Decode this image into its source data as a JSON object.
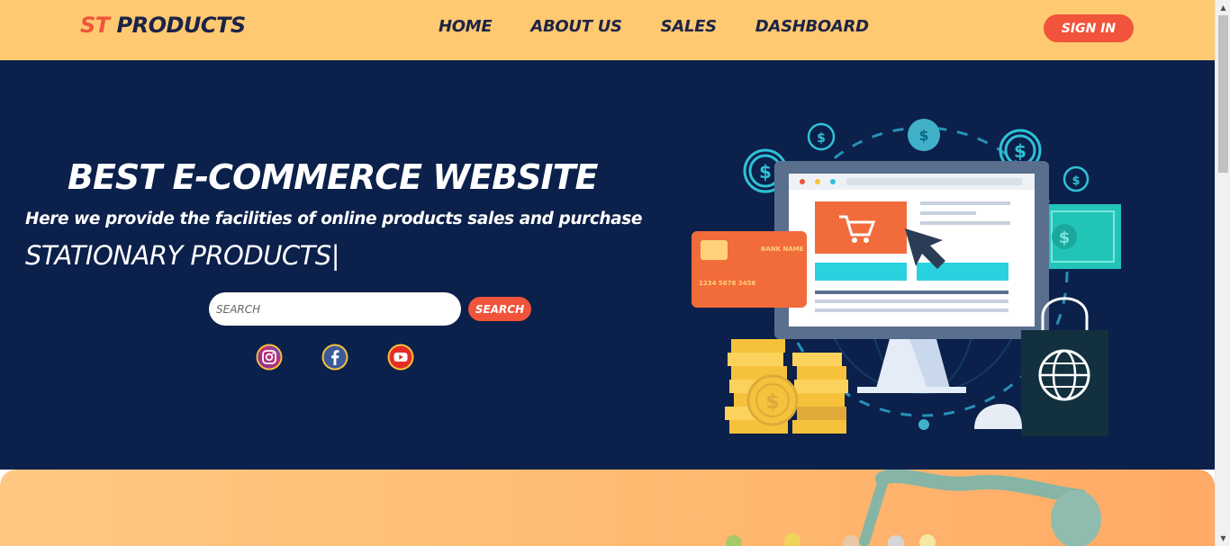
{
  "header": {
    "brand_accent": "ST",
    "brand_rest": "PRODUCTS",
    "nav": [
      "HOME",
      "ABOUT US",
      "SALES",
      "DASHBOARD"
    ],
    "signin_label": "SIGN IN"
  },
  "hero": {
    "title": "BEST E-COMMERCE WEBSITE",
    "subtitle": "Here we provide the facilities of online products sales and purchase",
    "typed_text": "STATIONARY PRODUCTS|",
    "search_placeholder": "SEARCH",
    "search_button": "SEARCH",
    "social_icons": [
      "instagram-icon",
      "facebook-icon",
      "youtube-icon"
    ]
  },
  "illustration": {
    "card_bank": "BANK NAME",
    "card_number": "1234  5678  3456"
  },
  "colors": {
    "header_bg": "#ffc971",
    "hero_bg": "#0b204a",
    "accent": "#f1543a"
  }
}
